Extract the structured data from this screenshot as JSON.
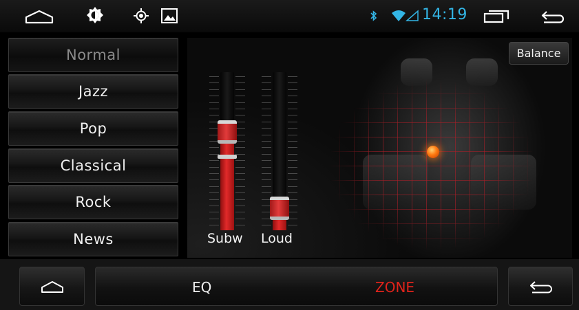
{
  "status_bar": {
    "time": "14:19",
    "icons": [
      "home-outline-icon",
      "brightness-icon",
      "gps-icon",
      "gallery-icon",
      "bluetooth-icon",
      "wifi-icon",
      "signal-icon",
      "recent-apps-icon",
      "back-icon"
    ]
  },
  "eq_presets": [
    {
      "label": "Normal",
      "selected": true
    },
    {
      "label": "Jazz",
      "selected": false
    },
    {
      "label": "Pop",
      "selected": false
    },
    {
      "label": "Classical",
      "selected": false
    },
    {
      "label": "Rock",
      "selected": false
    },
    {
      "label": "News",
      "selected": false
    }
  ],
  "balance_button": "Balance",
  "sliders": [
    {
      "label": "Subw",
      "level": 0.62
    },
    {
      "label": "Loud",
      "level": 0.14
    }
  ],
  "bottom_bar": {
    "tabs": [
      {
        "label": "EQ",
        "active": false
      },
      {
        "label": "ZONE",
        "active": true
      }
    ],
    "home_icon": "home-icon",
    "back_icon": "back-icon"
  },
  "colors": {
    "accent_blue": "#33b5e5",
    "active_tab": "#e0231b",
    "slider_red": "#e22a2a",
    "balance_dot": "#ff7a10"
  }
}
